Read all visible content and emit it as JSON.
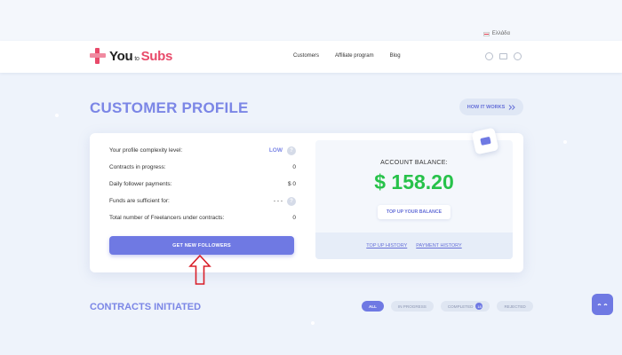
{
  "lang": {
    "label": "Ελλάδα"
  },
  "header": {
    "logo": {
      "you": "You",
      "to": "to",
      "subs": "Subs"
    },
    "nav": [
      "Customers",
      "Affiliate program",
      "Blog"
    ]
  },
  "page": {
    "title": "CUSTOMER PROFILE",
    "how_it_works": "HOW IT WORKS",
    "how_icon": "double-chevron-right-icon"
  },
  "profile": {
    "stats": [
      {
        "label": "Your profile complexity level:",
        "value": "LOW",
        "help": true
      },
      {
        "label": "Contracts in progress:",
        "value": "0",
        "help": false
      },
      {
        "label": "Daily follower payments:",
        "value": "$ 0",
        "help": false
      },
      {
        "label": "Funds are sufficient for:",
        "value": "- - -",
        "help": true
      },
      {
        "label": "Total number of Freelancers under contracts:",
        "value": "0",
        "help": false
      }
    ],
    "get_followers": "GET NEW FOLLOWERS"
  },
  "balance": {
    "label": "ACCOUNT BALANCE:",
    "amount": "$ 158.20",
    "top_up": "TOP UP YOUR BALANCE",
    "top_up_history": "TOP UP HISTORY",
    "payment_history": "PAYMENT HISTORY"
  },
  "contracts": {
    "title": "CONTRACTS INITIATED",
    "filters": [
      "ALL",
      "IN PROGRESS",
      "COMPLETED",
      "REJECTED"
    ],
    "completed_count": "18"
  },
  "colors": {
    "accent": "#6f79e3",
    "title": "#7b86e6",
    "balance": "#27c24a",
    "brand": "#e84a6a",
    "arrow": "#d9202a"
  }
}
